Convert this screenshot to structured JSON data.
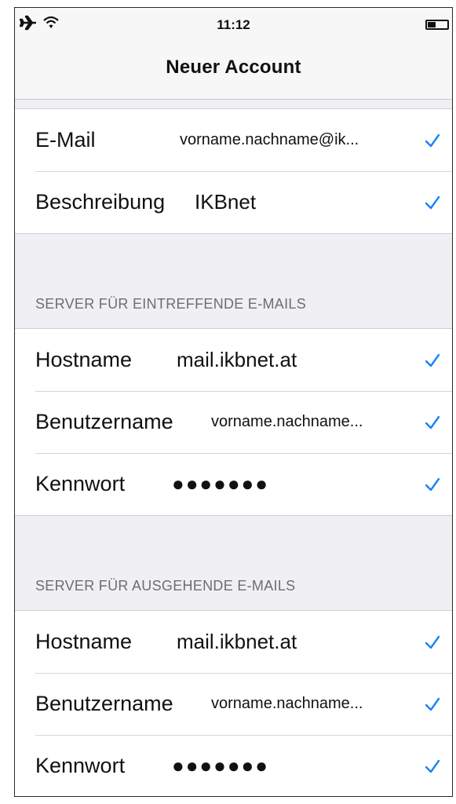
{
  "status_bar": {
    "time": "11:12",
    "icons": [
      "airplane-icon",
      "wifi-icon",
      "battery-icon"
    ]
  },
  "nav": {
    "title": "Neuer Account"
  },
  "account_group": [
    {
      "label": "E-Mail",
      "value": "vorname.nachname@ik..."
    },
    {
      "label": "Beschreibung",
      "value": "IKBnet"
    }
  ],
  "incoming": {
    "header": "SERVER FÜR EINTREFFENDE E-MAILS",
    "rows": [
      {
        "label": "Hostname",
        "value": "mail.ikbnet.at"
      },
      {
        "label": "Benutzername",
        "value": "vorname.nachname..."
      },
      {
        "label": "Kennwort",
        "value": "●●●●●●●"
      }
    ]
  },
  "outgoing": {
    "header": "SERVER FÜR AUSGEHENDE E-MAILS",
    "rows": [
      {
        "label": "Hostname",
        "value": "mail.ikbnet.at"
      },
      {
        "label": "Benutzername",
        "value": "vorname.nachname..."
      },
      {
        "label": "Kennwort",
        "value": "●●●●●●●"
      }
    ]
  },
  "colors": {
    "accent": "#1a82f7",
    "background": "#efeff4",
    "section_header": "#6d6d72"
  }
}
